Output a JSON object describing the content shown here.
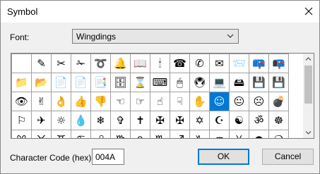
{
  "dialog": {
    "title": "Symbol",
    "close_icon": "close-icon"
  },
  "font": {
    "label": "Font:",
    "value": "Wingdings"
  },
  "symbols": [
    [
      " ",
      "✎",
      "✂",
      "✁",
      "➰",
      "🔔",
      "📖",
      "🕯",
      "☎",
      "✆",
      "✉",
      "📨",
      "📪",
      "📭"
    ],
    [
      "📁",
      "📂",
      "📄",
      "📄",
      "📑",
      "🗄",
      "⌛",
      "⌨",
      "🖱",
      "🖲",
      "💻",
      "🖴",
      "💾",
      "💾"
    ],
    [
      "👁",
      "✌",
      "👌",
      "👍",
      "👎",
      "☜",
      "☞",
      "☝",
      "☟",
      "✋",
      "☺",
      "😐",
      "☹",
      "💣"
    ],
    [
      "⚐",
      "✈",
      "☼",
      "💧",
      "❄",
      "✞",
      "✝",
      "✠",
      "✠",
      "✡",
      "☪",
      "☯",
      "ॐ",
      "☸"
    ],
    [
      "♈",
      "♉",
      "♊",
      "♋",
      "♌",
      "♍",
      "♎",
      "♏",
      "♐",
      "♑",
      "♒",
      "♓",
      "●",
      "❍"
    ]
  ],
  "selected_symbol": "☺",
  "character_code": {
    "label": "Character Code (hex):",
    "value": "004A"
  },
  "buttons": {
    "ok": "OK",
    "cancel": "Cancel"
  }
}
